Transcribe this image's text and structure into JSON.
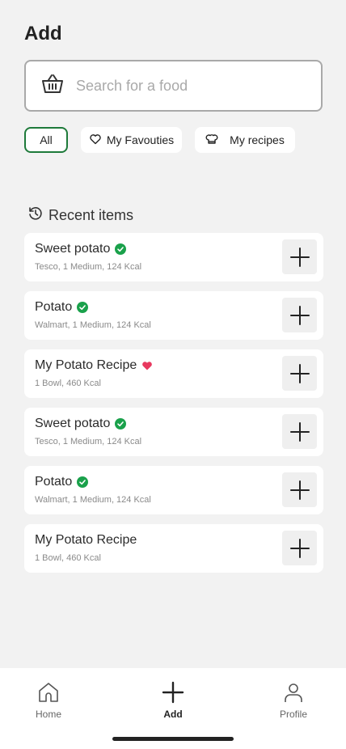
{
  "header": {
    "title": "Add"
  },
  "search": {
    "placeholder": "Search for a food",
    "icon": "basket-icon"
  },
  "filters": [
    {
      "label": "All",
      "selected": true
    },
    {
      "label": "My Favouties",
      "icon": "heart-outline-icon"
    },
    {
      "label": "My recipes",
      "icon": "chef-hat-icon"
    }
  ],
  "recent": {
    "heading": "Recent items",
    "icon": "history-icon",
    "items": [
      {
        "name": "Sweet potato",
        "details": "Tesco, 1 Medium, 124 Kcal",
        "badge": "verified"
      },
      {
        "name": "Potato",
        "details": "Walmart, 1 Medium, 124 Kcal",
        "badge": "verified"
      },
      {
        "name": "My Potato Recipe",
        "details": "1 Bowl, 460 Kcal",
        "badge": "favourite"
      },
      {
        "name": "Sweet potato",
        "details": "Tesco, 1 Medium, 124 Kcal",
        "badge": "verified"
      },
      {
        "name": "Potato",
        "details": "Walmart, 1 Medium, 124 Kcal",
        "badge": "verified"
      },
      {
        "name": "My Potato Recipe",
        "details": "1 Bowl, 460 Kcal",
        "badge": "none"
      }
    ]
  },
  "tabbar": {
    "home": "Home",
    "add": "Add",
    "profile": "Profile"
  },
  "colors": {
    "accent": "#1e7a3a",
    "verified": "#1aa14b",
    "favourite": "#e8395f",
    "background": "#f2f2f2"
  }
}
